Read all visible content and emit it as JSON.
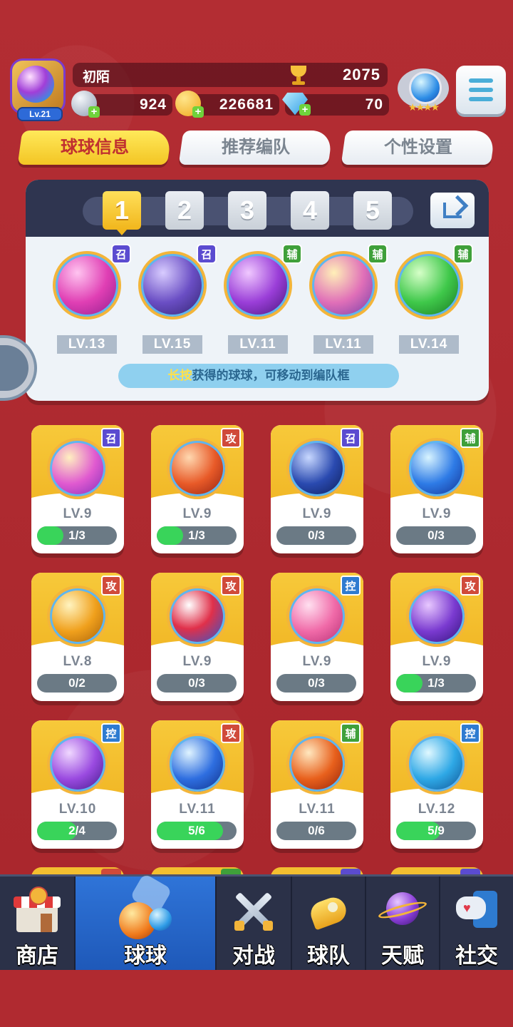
{
  "player": {
    "name": "初陌",
    "level": "Lv.21",
    "trophies": "2075"
  },
  "resources": {
    "energy": "924",
    "coins": "226681",
    "diamonds": "70"
  },
  "tabs": [
    "球球信息",
    "推荐编队",
    "个性设置"
  ],
  "squad": {
    "slots": [
      "1",
      "2",
      "3",
      "4",
      "5"
    ],
    "selected_slot": "1",
    "balls": [
      {
        "tag": "召",
        "level": "LV.13",
        "icon": "sword-orb"
      },
      {
        "tag": "召",
        "level": "LV.15",
        "icon": "ghost-cat-orb"
      },
      {
        "tag": "辅",
        "level": "LV.11",
        "icon": "leaf-orb"
      },
      {
        "tag": "辅",
        "level": "LV.11",
        "icon": "crowd-orb"
      },
      {
        "tag": "辅",
        "level": "LV.14",
        "icon": "arrow-up-orb"
      }
    ],
    "hint_highlight": "长按",
    "hint_rest": "获得的球球，可移动到编队框"
  },
  "cards": [
    {
      "tag": "召",
      "level": "LV.9",
      "progress": "1/3",
      "fraction": 0.333,
      "icon": "phoenix-orb"
    },
    {
      "tag": "攻",
      "level": "LV.9",
      "progress": "1/3",
      "fraction": 0.333,
      "icon": "flame-orb"
    },
    {
      "tag": "召",
      "level": "LV.9",
      "progress": "0/3",
      "fraction": 0,
      "icon": "void-orb"
    },
    {
      "tag": "辅",
      "level": "LV.9",
      "progress": "0/3",
      "fraction": 0,
      "icon": "ice-crystal-orb"
    },
    {
      "tag": "攻",
      "level": "LV.8",
      "progress": "0/2",
      "fraction": 0,
      "icon": "knight-orb"
    },
    {
      "tag": "攻",
      "level": "LV.9",
      "progress": "0/3",
      "fraction": 0,
      "icon": "yinyang-orb"
    },
    {
      "tag": "控",
      "level": "LV.9",
      "progress": "0/3",
      "fraction": 0,
      "icon": "heart-orb"
    },
    {
      "tag": "攻",
      "level": "LV.9",
      "progress": "1/3",
      "fraction": 0.333,
      "icon": "sword-cross-orb"
    },
    {
      "tag": "控",
      "level": "LV.10",
      "progress": "2/4",
      "fraction": 0.5,
      "icon": "butterfly-orb"
    },
    {
      "tag": "攻",
      "level": "LV.11",
      "progress": "5/6",
      "fraction": 0.833,
      "icon": "vortex-orb"
    },
    {
      "tag": "辅",
      "level": "LV.11",
      "progress": "0/6",
      "fraction": 0,
      "icon": "wings-orb"
    },
    {
      "tag": "控",
      "level": "LV.12",
      "progress": "5/9",
      "fraction": 0.556,
      "icon": "wave-orb"
    }
  ],
  "nav": [
    {
      "label": "商店",
      "icon": "shop-icon"
    },
    {
      "label": "球球",
      "icon": "balls-icon"
    },
    {
      "label": "对战",
      "icon": "crossed-swords-icon"
    },
    {
      "label": "球队",
      "icon": "whistle-icon"
    },
    {
      "label": "天赋",
      "icon": "planet-icon"
    },
    {
      "label": "社交",
      "icon": "chat-heart-icon"
    }
  ],
  "colors": {
    "background": "#b02a30",
    "active_tab": "#f3c524",
    "nav_active": "#2f74d8",
    "progress_fill": "#39d45a"
  }
}
